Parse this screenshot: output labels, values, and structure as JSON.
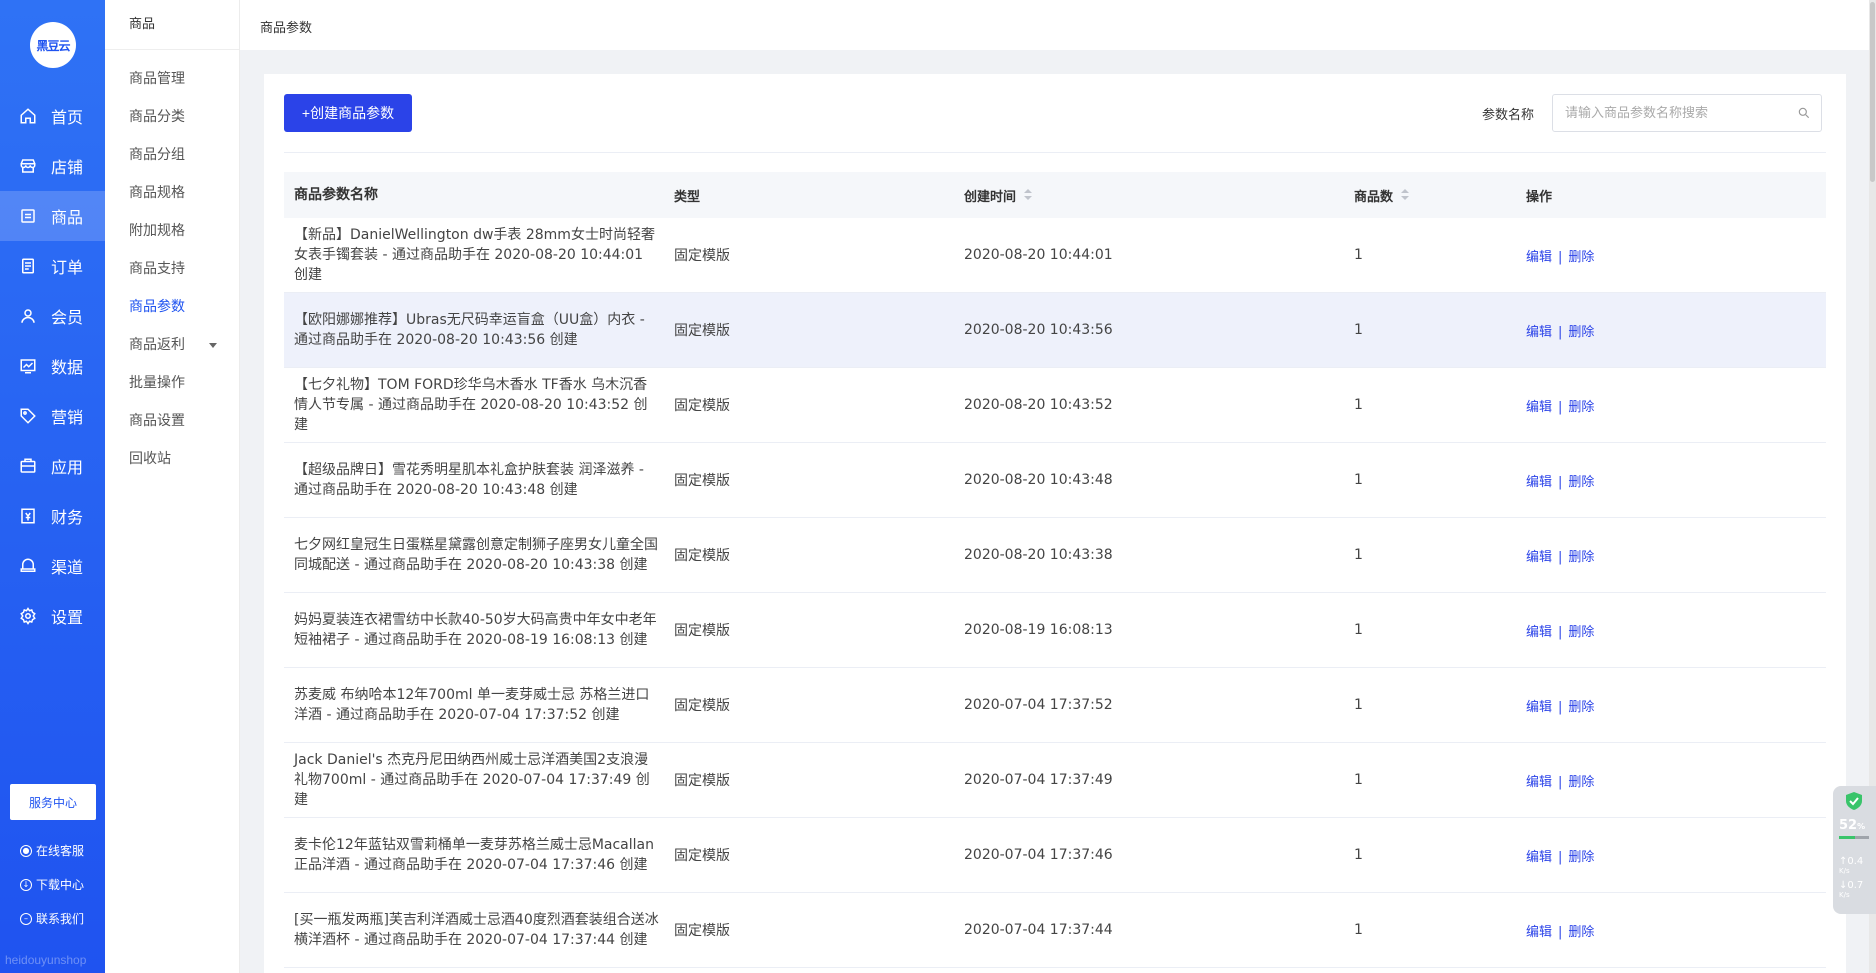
{
  "nav": {
    "logo": "黑豆云",
    "items": [
      {
        "label": "首页",
        "icon": "home-icon"
      },
      {
        "label": "店铺",
        "icon": "store-icon"
      },
      {
        "label": "商品",
        "icon": "goods-icon",
        "active": true
      },
      {
        "label": "订单",
        "icon": "order-icon"
      },
      {
        "label": "会员",
        "icon": "user-icon"
      },
      {
        "label": "数据",
        "icon": "chart-icon"
      },
      {
        "label": "营销",
        "icon": "tag-icon"
      },
      {
        "label": "应用",
        "icon": "app-icon"
      },
      {
        "label": "财务",
        "icon": "finance-icon"
      },
      {
        "label": "渠道",
        "icon": "channel-icon"
      },
      {
        "label": "设置",
        "icon": "gear-icon"
      }
    ],
    "service_center": "服务中心",
    "online_service": "在线客服",
    "download_center": "下载中心",
    "contact_us": "联系我们",
    "brand_footer": "heidouyunshop"
  },
  "subnav": {
    "title": "商品",
    "items": [
      {
        "label": "商品管理"
      },
      {
        "label": "商品分类"
      },
      {
        "label": "商品分组"
      },
      {
        "label": "商品规格"
      },
      {
        "label": "附加规格"
      },
      {
        "label": "商品支持"
      },
      {
        "label": "商品参数",
        "active": true
      },
      {
        "label": "商品返利",
        "has_caret": true
      },
      {
        "label": "批量操作"
      },
      {
        "label": "商品设置"
      },
      {
        "label": "回收站"
      }
    ]
  },
  "breadcrumb": "商品参数",
  "toolbar": {
    "create_label": "+创建商品参数",
    "search_label": "参数名称",
    "search_placeholder": "请输入商品参数名称搜索"
  },
  "table": {
    "headers": {
      "name": "商品参数名称",
      "type": "类型",
      "created": "创建时间",
      "count": "商品数",
      "ops": "操作"
    },
    "edit_label": "编辑",
    "sep": "|",
    "delete_label": "删除",
    "rows": [
      {
        "name": "【新品】DanielWellington dw手表 28mm女士时尚轻奢女表手镯套装 - 通过商品助手在 2020-08-20 10:44:01 创建",
        "type": "固定模版",
        "created": "2020-08-20 10:44:01",
        "count": "1"
      },
      {
        "name": "【欧阳娜娜推荐】Ubras无尺码幸运盲盒（UU盒）内衣 - 通过商品助手在 2020-08-20 10:43:56 创建",
        "type": "固定模版",
        "created": "2020-08-20 10:43:56",
        "count": "1"
      },
      {
        "name": "【七夕礼物】TOM FORD珍华乌木香水 TF香水 乌木沉香 情人节专属 - 通过商品助手在 2020-08-20 10:43:52 创建",
        "type": "固定模版",
        "created": "2020-08-20 10:43:52",
        "count": "1"
      },
      {
        "name": "【超级品牌日】雪花秀明星肌本礼盒护肤套装 润泽滋养 - 通过商品助手在 2020-08-20 10:43:48 创建",
        "type": "固定模版",
        "created": "2020-08-20 10:43:48",
        "count": "1"
      },
      {
        "name": "七夕网红皇冠生日蛋糕星黛露创意定制狮子座男女儿童全国同城配送 - 通过商品助手在 2020-08-20 10:43:38 创建",
        "type": "固定模版",
        "created": "2020-08-20 10:43:38",
        "count": "1"
      },
      {
        "name": "妈妈夏装连衣裙雪纺中长款40-50岁大码高贵中年女中老年短袖裙子 - 通过商品助手在 2020-08-19 16:08:13 创建",
        "type": "固定模版",
        "created": "2020-08-19 16:08:13",
        "count": "1"
      },
      {
        "name": "苏麦威 布纳哈本12年700ml 单一麦芽威士忌 苏格兰进口洋酒 - 通过商品助手在 2020-07-04 17:37:52 创建",
        "type": "固定模版",
        "created": "2020-07-04 17:37:52",
        "count": "1"
      },
      {
        "name": "Jack Daniel's 杰克丹尼田纳西州威士忌洋酒美国2支浪漫礼物700ml - 通过商品助手在 2020-07-04 17:37:49 创建",
        "type": "固定模版",
        "created": "2020-07-04 17:37:49",
        "count": "1"
      },
      {
        "name": "麦卡伦12年蓝钻双雪莉桶单一麦芽苏格兰威士忌Macallan正品洋酒 - 通过商品助手在 2020-07-04 17:37:46 创建",
        "type": "固定模版",
        "created": "2020-07-04 17:37:46",
        "count": "1"
      },
      {
        "name": "[买一瓶发两瓶]芙吉利洋酒威士忌酒40度烈酒套装组合送冰横洋酒杯 - 通过商品助手在 2020-07-04 17:37:44 创建",
        "type": "固定模版",
        "created": "2020-07-04 17:37:44",
        "count": "1"
      }
    ]
  },
  "monitor": {
    "percent": "52",
    "percent_unit": "%",
    "percent_value": 0.52,
    "up_speed": "0.4",
    "down_speed": "0.7",
    "speed_unit": "K/s"
  },
  "colors": {
    "primary": "#2b43e8",
    "nav_bg": "#1f53f0",
    "hover_row": "#eef1fb"
  }
}
